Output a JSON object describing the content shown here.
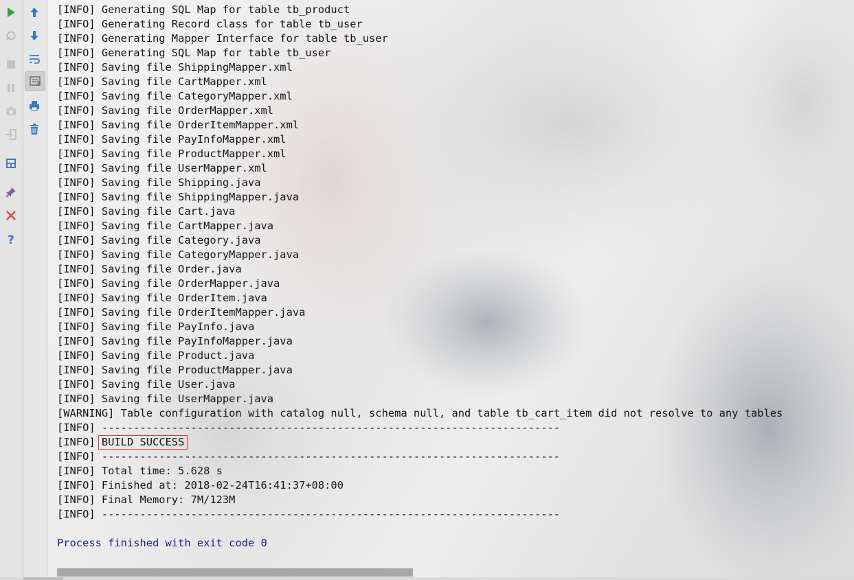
{
  "toolbar_left": [
    {
      "name": "run-icon",
      "enabled": true,
      "color": "#3aa13a"
    },
    {
      "name": "rerun-icon",
      "enabled": false
    },
    {
      "name": "stop-icon",
      "enabled": false
    },
    {
      "name": "pause-icon",
      "enabled": false
    },
    {
      "name": "dump-threads-icon",
      "enabled": false
    },
    {
      "name": "exit-icon",
      "enabled": false
    },
    {
      "name": "restore-layout-icon",
      "enabled": true
    },
    {
      "name": "pin-icon",
      "enabled": true
    },
    {
      "name": "close-icon",
      "enabled": true,
      "color": "#d94a4a"
    },
    {
      "name": "help-icon",
      "enabled": true,
      "color": "#3a79c8"
    }
  ],
  "toolbar_right": [
    {
      "name": "scroll-up-icon"
    },
    {
      "name": "scroll-down-icon"
    },
    {
      "name": "soft-wrap-icon"
    },
    {
      "name": "scroll-to-end-icon",
      "active": true
    },
    {
      "name": "print-icon"
    },
    {
      "name": "clear-all-icon"
    }
  ],
  "console": {
    "lines": [
      "[INFO] Generating SQL Map for table tb_product",
      "[INFO] Generating Record class for table tb_user",
      "[INFO] Generating Mapper Interface for table tb_user",
      "[INFO] Generating SQL Map for table tb_user",
      "[INFO] Saving file ShippingMapper.xml",
      "[INFO] Saving file CartMapper.xml",
      "[INFO] Saving file CategoryMapper.xml",
      "[INFO] Saving file OrderMapper.xml",
      "[INFO] Saving file OrderItemMapper.xml",
      "[INFO] Saving file PayInfoMapper.xml",
      "[INFO] Saving file ProductMapper.xml",
      "[INFO] Saving file UserMapper.xml",
      "[INFO] Saving file Shipping.java",
      "[INFO] Saving file ShippingMapper.java",
      "[INFO] Saving file Cart.java",
      "[INFO] Saving file CartMapper.java",
      "[INFO] Saving file Category.java",
      "[INFO] Saving file CategoryMapper.java",
      "[INFO] Saving file Order.java",
      "[INFO] Saving file OrderMapper.java",
      "[INFO] Saving file OrderItem.java",
      "[INFO] Saving file OrderItemMapper.java",
      "[INFO] Saving file PayInfo.java",
      "[INFO] Saving file PayInfoMapper.java",
      "[INFO] Saving file Product.java",
      "[INFO] Saving file ProductMapper.java",
      "[INFO] Saving file User.java",
      "[INFO] Saving file UserMapper.java",
      "[WARNING] Table configuration with catalog null, schema null, and table tb_cart_item did not resolve to any tables",
      "[INFO] ------------------------------------------------------------------------"
    ],
    "build_prefix": "[INFO] ",
    "build_status": "BUILD SUCCESS",
    "summary_lines": [
      "[INFO] ------------------------------------------------------------------------",
      "[INFO] Total time: 5.628 s",
      "[INFO] Finished at: 2018-02-24T16:41:37+08:00",
      "[INFO] Final Memory: 7M/123M",
      "[INFO] ------------------------------------------------------------------------"
    ],
    "exit_message": "Process finished with exit code 0",
    "text_color": "#141414",
    "exit_color": "#1a1f8e",
    "highlight_color": "#d43a3a"
  }
}
